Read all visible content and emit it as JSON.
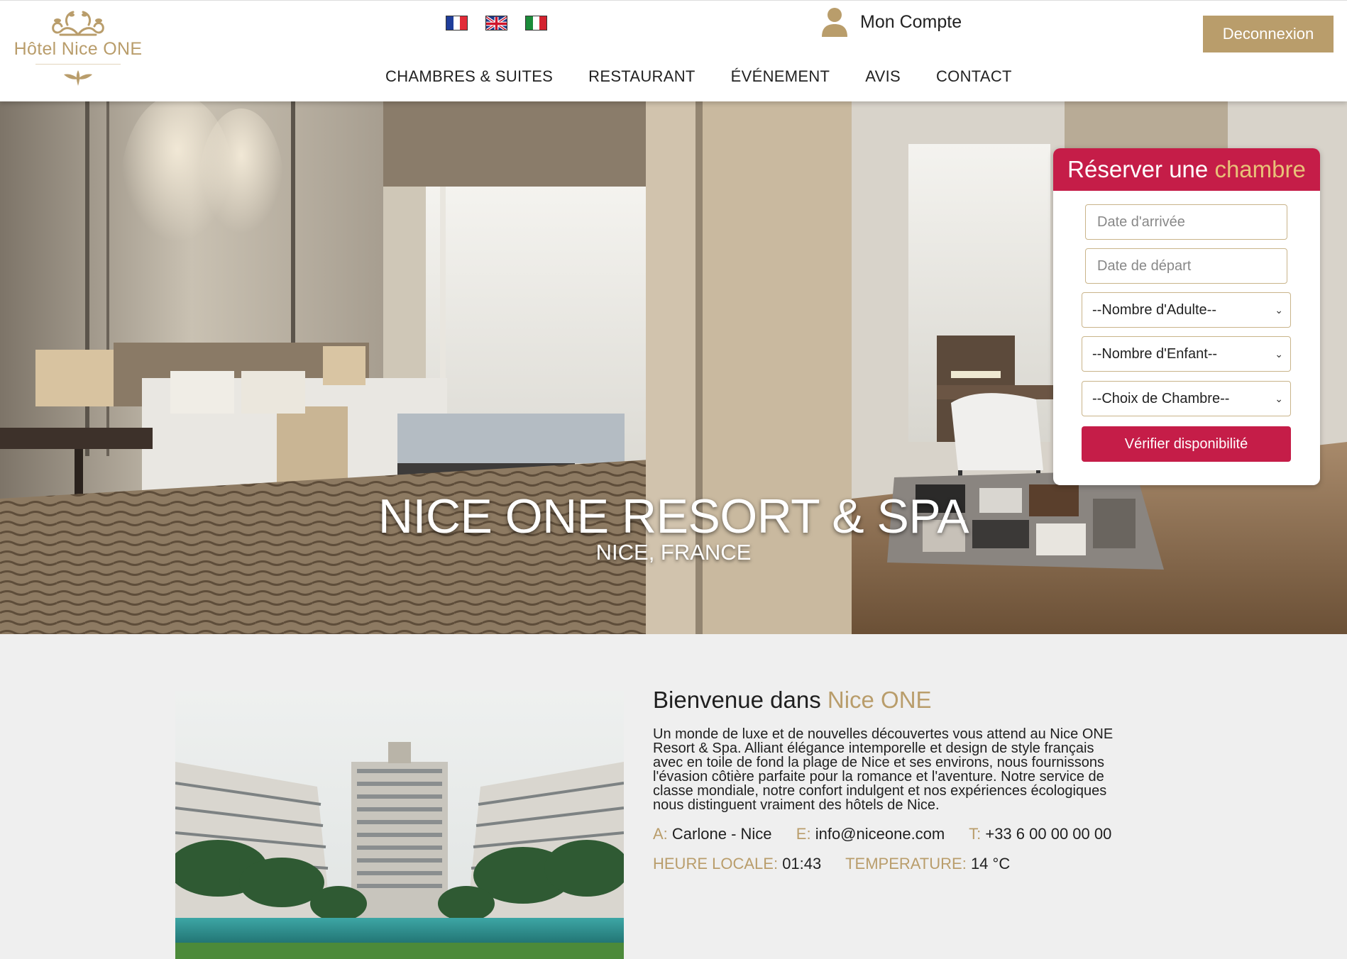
{
  "header": {
    "logo_text": "Hôtel Nice ONE",
    "languages": [
      "fr",
      "en",
      "it"
    ],
    "account_label": "Mon Compte",
    "logout_label": "Deconnexion",
    "nav": [
      "CHAMBRES & SUITES",
      "RESTAURANT",
      "ÉVÉNEMENT",
      "AVIS",
      "CONTACT"
    ]
  },
  "hero": {
    "title": "NICE ONE RESORT & SPA",
    "subtitle": "NICE, FRANCE"
  },
  "booking": {
    "title_part1": "Réserver une",
    "title_part2": "chambre",
    "arrival_placeholder": "Date d'arrivée",
    "departure_placeholder": "Date de départ",
    "adults_selected": "--Nombre d'Adulte--",
    "children_selected": "--Nombre d'Enfant--",
    "room_selected": "--Choix de Chambre--",
    "check_label": "Vérifier disponibilité"
  },
  "welcome": {
    "title_part1": "Bienvenue dans",
    "title_part2": "Nice ONE",
    "text_lines": [
      "Un monde de luxe et de nouvelles découvertes vous attend au Nice ONE",
      "Resort & Spa. Alliant élégance intemporelle et design de style français",
      "avec en toile de fond la plage de Nice et ses environs, nous fournissons",
      "l'évasion côtière parfaite pour la romance et l'aventure. Notre service de",
      "classe mondiale, notre confort indulgent et nos expériences écologiques",
      "nous distinguent vraiment des hôtels de Nice."
    ],
    "address_label": "A:",
    "address": "Carlone - Nice",
    "email_label": "E:",
    "email": "info@niceone.com",
    "phone_label": "T:",
    "phone": "+33 6 00 00 00 00",
    "time_label": "HEURE LOCALE:",
    "time": "01:43",
    "temp_label": "TEMPERATURE:",
    "temp": "14 °C"
  },
  "colors": {
    "gold": "#b99d6b",
    "crimson": "#c51d48",
    "background": "#efefef"
  }
}
